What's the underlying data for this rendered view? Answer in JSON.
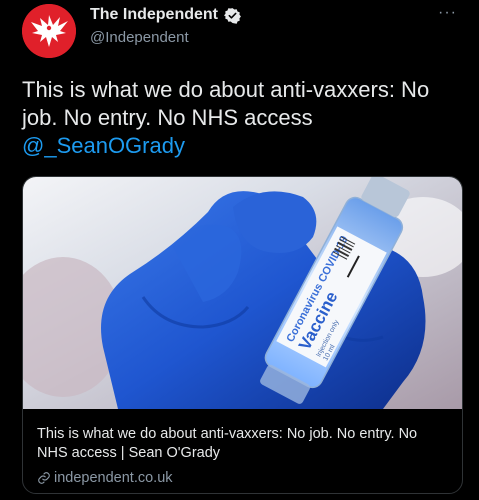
{
  "account": {
    "display_name": "The Independent",
    "handle": "@Independent",
    "verified": true,
    "avatar_icon": "eagle-logo-icon",
    "avatar_color": "#e0202a"
  },
  "menu": {
    "more_icon": "more-horizontal-icon",
    "more_label": "···"
  },
  "tweet": {
    "text": "This is what we do about anti-vaxxers: No job. No entry. No NHS access",
    "mention": "@_SeanOGrady",
    "mention_color": "#1d9bf0"
  },
  "card": {
    "image": {
      "vial_label_line1": "Coronavirus COVID-19",
      "vial_label_line2": "Vaccine",
      "vial_label_line3": "Injection only",
      "vial_label_line4": "10 ml"
    },
    "title": "This is what we do about anti-vaxxers: No job. No entry. No NHS access | Sean O'Grady",
    "domain": "independent.co.uk",
    "link_icon": "link-icon"
  }
}
